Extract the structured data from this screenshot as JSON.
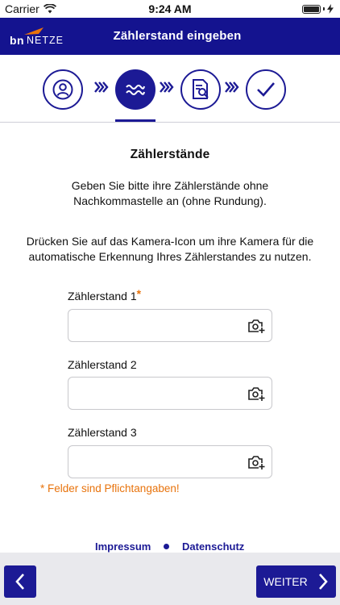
{
  "status_bar": {
    "carrier": "Carrier",
    "time": "9:24 AM"
  },
  "header": {
    "logo_bn": "bn",
    "logo_netze": "NETZE",
    "title": "Zählerstand eingeben"
  },
  "stepper": {
    "steps": [
      {
        "icon": "user-icon",
        "active": false
      },
      {
        "icon": "meter-wave-icon",
        "active": true
      },
      {
        "icon": "document-search-icon",
        "active": false
      },
      {
        "icon": "checkmark-icon",
        "active": false
      }
    ]
  },
  "main": {
    "section_title": "Zählerstände",
    "intro": "Geben Sie bitte ihre Zählerstände ohne Nachkommastelle an (ohne Rundung).",
    "camera_hint": "Drücken Sie auf das Kamera-Icon um ihre Kamera für die automatische Erkennung Ihres Zählerstandes zu nutzen.",
    "fields": [
      {
        "label": "Zählerstand 1",
        "required_marker": "*",
        "value": "",
        "placeholder": ""
      },
      {
        "label": "Zählerstand 2",
        "value": "",
        "placeholder": ""
      },
      {
        "label": "Zählerstand 3",
        "value": "",
        "placeholder": ""
      }
    ],
    "required_note": "* Felder sind Pflichtangaben!"
  },
  "footer": {
    "impressum": "Impressum",
    "datenschutz": "Datenschutz"
  },
  "nav": {
    "next_label": "WEITER"
  },
  "colors": {
    "brand": "#14138f",
    "accent": "#e8730c"
  }
}
